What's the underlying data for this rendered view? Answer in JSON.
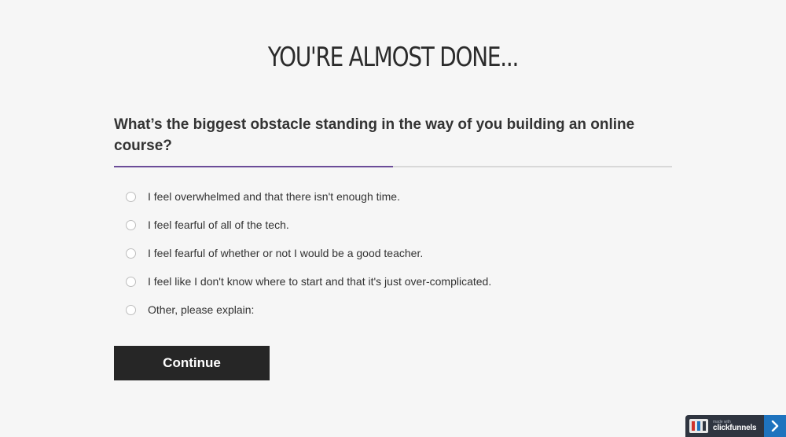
{
  "headline": "YOU'RE ALMOST DONE...",
  "question": "What’s the biggest obstacle standing in the way of you building an online course?",
  "progress": {
    "value_fraction": 0.5,
    "fill_color": "#6b4c98",
    "track_color": "#d8d8d8"
  },
  "options": [
    {
      "label": "I feel overwhelmed and that there isn't enough time."
    },
    {
      "label": "I feel fearful of all of the tech."
    },
    {
      "label": "I feel fearful of whether or not I would be a good teacher."
    },
    {
      "label": "I feel like I don't know where to start and that it's just over-complicated."
    },
    {
      "label": "Other, please explain:"
    }
  ],
  "continue_label": "Continue",
  "badge": {
    "small_text": "made with",
    "brand_text": "clickfunnels",
    "logo_icon": "clickfunnels-logo-icon",
    "arrow_icon": "chevron-right-icon",
    "accent_color": "#1e73be"
  }
}
